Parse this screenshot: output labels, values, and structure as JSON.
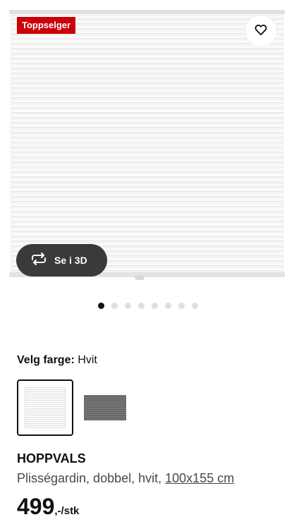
{
  "badge": {
    "text": "Toppselger",
    "color": "#cc0008"
  },
  "favorite": {
    "icon": "heart-outline-icon"
  },
  "view3d": {
    "icon": "rotate-3d-icon",
    "label": "Se i 3D"
  },
  "carousel": {
    "total": 8,
    "active_index": 0
  },
  "color": {
    "label": "Velg farge:",
    "value": "Hvit",
    "options": [
      "Hvit",
      "Grå"
    ],
    "selected": "Hvit"
  },
  "product": {
    "name": "HOPPVALS",
    "description": "Plisségardin, dobbel, hvit,",
    "size": "100x155 cm",
    "price_amount": "499",
    "price_suffix": ",-/stk"
  }
}
